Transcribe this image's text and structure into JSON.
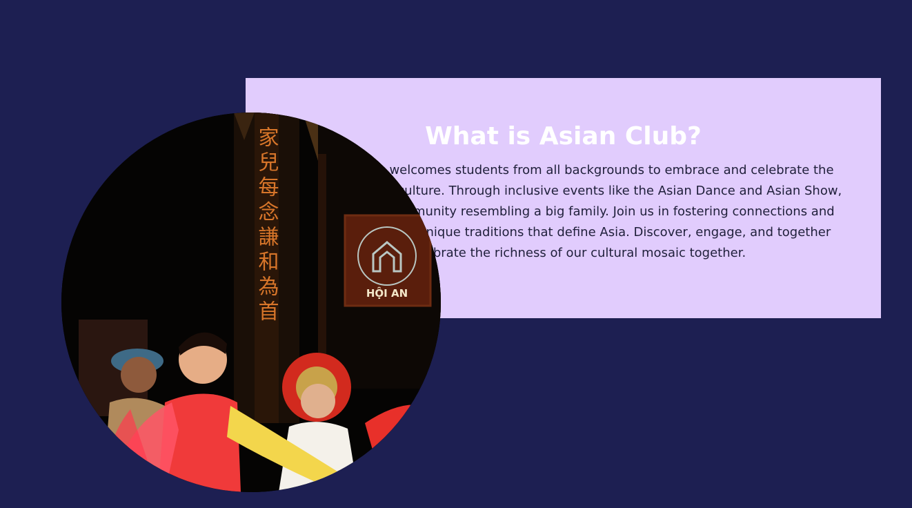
{
  "about": {
    "title": "What is Asian Club?",
    "description": "Asian Club welcomes students from all backgrounds to embrace and celebrate the vibrant Asian culture. Through inclusive events like the Asian Dance and Asian Show, we build a community resembling a big family. Join us in fostering connections and respect for the unique traditions that define Asia. Discover, engage, and together celebrate the richness of our cultural mosaic together."
  },
  "photo": {
    "sign_text": "HỘI AN",
    "calligraphy": "家兒每念謙和為首"
  },
  "colors": {
    "page_background": "#1d1f52",
    "card_background": "#e1ccfd",
    "title_color": "#ffffff",
    "text_color": "#1f1f3a"
  }
}
